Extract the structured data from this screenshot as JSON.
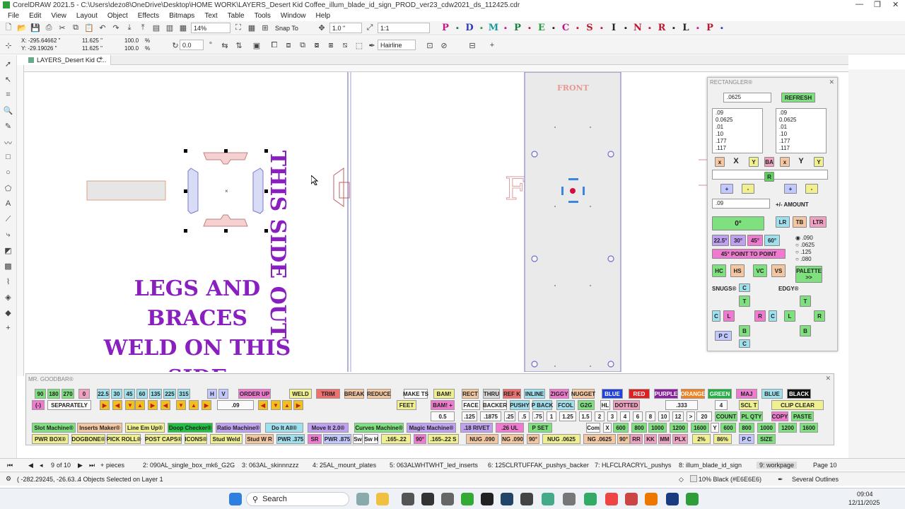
{
  "window": {
    "title": "CorelDRAW 2021.5 - C:\\Users\\dezo8\\OneDrive\\Desktop\\HOME WORK\\LAYERS_Desert Kid Coffee_illum_blade_id_sign_PROD_ver23_cdw2021_ds_112425.cdr"
  },
  "menu": [
    "File",
    "Edit",
    "View",
    "Layout",
    "Object",
    "Effects",
    "Bitmaps",
    "Text",
    "Table",
    "Tools",
    "Window",
    "Help"
  ],
  "toolbar": {
    "zoom": "14%",
    "snap": "Snap To",
    "nudge": "1.0 \"",
    "scale": "1:1",
    "letters": [
      "P",
      "D",
      "M",
      "P",
      "E",
      "C",
      "S",
      "I",
      "N",
      "R",
      "L",
      "P"
    ]
  },
  "propbar": {
    "x": "X: -295.64662 \"",
    "y": "Y: -29.19026 \"",
    "w": "11.625 \"",
    "h": "11.625 \"",
    "sx": "100.0",
    "sy": "100.0",
    "pct": "%",
    "angle": "0.0",
    "outline": "Hairline"
  },
  "doc_tab": "LAYERS_Desert Kid C...",
  "canvas": {
    "front_label": "FRONT",
    "vertical_text": "THIS SIDE OUT",
    "legs_line1": "LEGS AND BRACES",
    "legs_line2": "WELD ON THIS SIDE"
  },
  "rectangler": {
    "title": "RECTANGLER®",
    "value": ".0625",
    "refresh": "REFRESH",
    "list1": [
      ".09",
      "0.0625",
      ".01",
      ".10",
      ".177",
      ".117"
    ],
    "list2": [
      ".09",
      "0.0625",
      ".01",
      ".10",
      ".177",
      ".117"
    ],
    "x_label": "X",
    "y_label": "Y",
    "ba": "BA",
    "r": "R",
    "small_x": "x",
    "small_y": "Y",
    "plus": "+",
    "minus": "-",
    "amount_value": ".09",
    "amount_label": "+/- AMOUNT",
    "angle": "0°",
    "lr": "LR",
    "tb": "TB",
    "ltr": "LTR",
    "a225": "22.5°",
    "a30": "30°",
    "a45": "45°",
    "a60": "60°",
    "radio": [
      ".090",
      ".0625",
      ".125",
      ".080"
    ],
    "p2p": "45° POINT TO POINT",
    "hc": "HC",
    "hs": "HS",
    "vc": "VC",
    "vs": "VS",
    "palette": "PALETTE >>",
    "snugs": "SNUGS®",
    "edgy": "EDGY®",
    "c": "C",
    "t": "T",
    "l": "L",
    "b": "B",
    "rr": "R",
    "pc": "P C"
  },
  "goodbar": {
    "title": "MR. GOODBAR®",
    "row1": [
      "90",
      "180",
      "270",
      "0",
      "22.5",
      "30",
      "45",
      "60",
      "135",
      "225",
      "315",
      "H",
      "V",
      "ORDER UP",
      "WELD",
      "TRIM",
      "BREAK",
      "REDUCE",
      "MAKE TS",
      "BAM!",
      "RECT",
      "THRU",
      "REF K",
      "INLINE",
      "ZIGGY",
      "NUGGET",
      "BLUE",
      "RED",
      "PURPLE",
      "ORANGE",
      "GREEN",
      "MAJ",
      "BLUE",
      "BLACK"
    ],
    "row2": [
      "(-)",
      "SEPARATELY",
      ".09",
      "FEET",
      "BAM! +",
      "FACE",
      "BACKER",
      "PUSHY",
      "P BACK",
      "FCOL",
      "G2G",
      "HL",
      "DOTTED",
      ".333",
      "4",
      "SCL T",
      "CLIP CLEAR"
    ],
    "row3": [
      "0.5",
      ".125",
      ".1875",
      ".25",
      ".5",
      ".75",
      "1",
      "1.25",
      "1.5",
      "2",
      "3",
      "4",
      "6",
      "8",
      "10",
      "12",
      ">",
      "20",
      "COUNT",
      "PL QTY",
      "COPY",
      "PASTE"
    ],
    "row4": [
      "Slot Machine®",
      "Inserts Maker®",
      "Line Em Up®",
      "Doop Checker®",
      "Ratio Machine®",
      "Do It All®",
      "Move It 2.0®",
      "Curves Machine®",
      "Magic Machine®",
      ".18 RIVET",
      ".26 UL",
      "P SET",
      "Com",
      "X",
      "600",
      "800",
      "1000",
      "1200",
      "1600",
      "Y",
      "600",
      "800",
      "1000",
      "1200",
      "1600"
    ],
    "row5": [
      "PWR BOX®",
      "DOGBONE®",
      "PICK ROLL®",
      "POST CAPS®",
      "ICONS®",
      "Stud Weld",
      "Stud W R",
      "PWR .375",
      "SR",
      "PWR .875",
      "Sw",
      "Sw H",
      ".165-.22",
      "90°",
      ".165-.22 S",
      "NUG .090",
      "NG .090",
      "90°",
      "NUG .0625",
      "NG .0625",
      "90°",
      "RR",
      "KK",
      "MM",
      "PLX",
      "2%",
      "86%",
      "P C",
      "SIZE"
    ]
  },
  "pages": {
    "counter": "9",
    "of": "of 10",
    "list": [
      "pieces",
      "2: 090AL_single_box_mk6_G2G",
      "3: 063AL_skinnnzzz",
      "4: 25AL_mount_plates",
      "5: 063ALWHTWHT_led_inserts",
      "6: 125CLRTUFFAK_pushys_backer",
      "7: HLFCLRACRYL_pushys",
      "8: illum_blade_id_sign",
      "9: workpage"
    ],
    "page_label": "Page 10"
  },
  "status": {
    "coords": "( -282.29245, -26.63...",
    "selection": "4 Objects Selected on Layer 1",
    "fill": "10% Black (#E6E6E6)",
    "outline": "Several Outlines"
  },
  "taskbar": {
    "search": "Search",
    "time": "09:04",
    "date": "12/11/2025"
  }
}
